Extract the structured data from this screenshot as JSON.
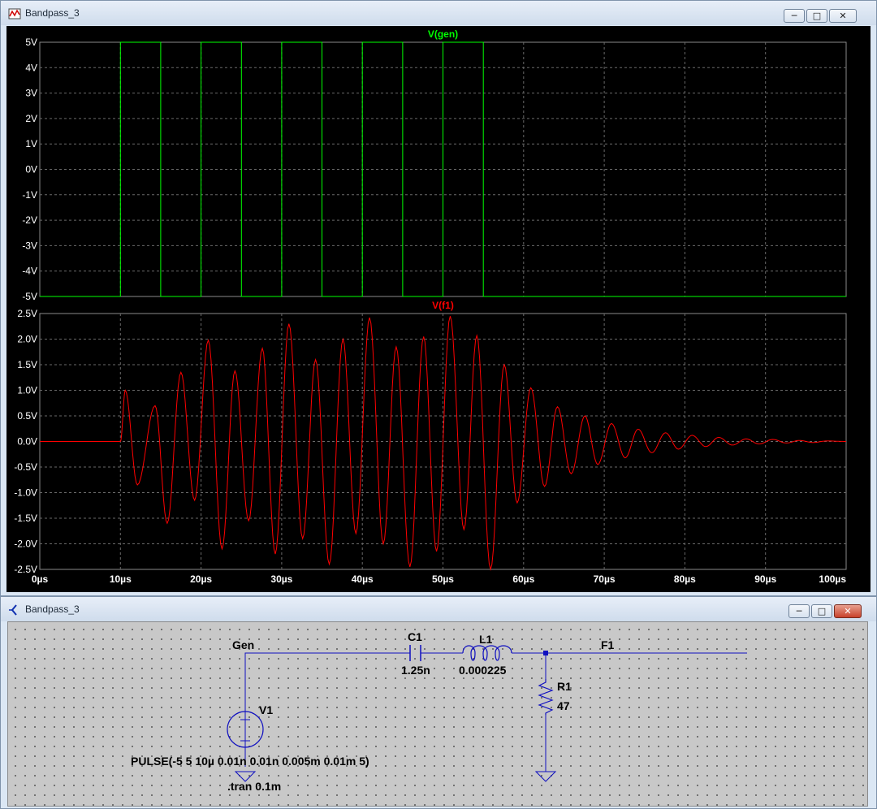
{
  "waveform_window": {
    "title": "Bandpass_3",
    "buttons": {
      "minimize": "─",
      "maximize": "□",
      "close": "✕"
    }
  },
  "schematic_window": {
    "title": "Bandpass_3",
    "buttons": {
      "minimize": "─",
      "maximize": "□",
      "close": "✕"
    }
  },
  "schematic": {
    "net_gen": "Gen",
    "net_f1": "F1",
    "c1_name": "C1",
    "c1_value": "1.25n",
    "l1_name": "L1",
    "l1_value": "0.000225",
    "r1_name": "R1",
    "r1_value": "47",
    "v1_name": "V1",
    "v1_value": "PULSE(-5 5 10µ 0.01n 0.01n 0.005m 0.01m 5)",
    "directive": ".tran 0.1m",
    "colors": {
      "wire": "#1010c0",
      "component": "#1010c0",
      "text": "#000000"
    }
  },
  "chart_data": [
    {
      "type": "line",
      "title": "V(gen)",
      "title_color": "#00ff00",
      "x_ticks": [
        "0µs",
        "10µs",
        "20µs",
        "30µs",
        "40µs",
        "50µs",
        "60µs",
        "70µs",
        "80µs",
        "90µs",
        "100µs"
      ],
      "y_ticks": [
        "5V",
        "4V",
        "3V",
        "2V",
        "1V",
        "0V",
        "-1V",
        "-2V",
        "-3V",
        "-4V",
        "-5V"
      ],
      "xlim": [
        0,
        100
      ],
      "ylim": [
        -5,
        5
      ],
      "grid": true,
      "series": [
        {
          "name": "V(gen)",
          "color": "#00ff00",
          "x": [
            0,
            10,
            10,
            15,
            15,
            20,
            20,
            25,
            25,
            30,
            30,
            35,
            35,
            40,
            40,
            45,
            45,
            50,
            50,
            55,
            55,
            100
          ],
          "y": [
            -5,
            -5,
            5,
            5,
            -5,
            -5,
            5,
            5,
            -5,
            -5,
            5,
            5,
            -5,
            -5,
            5,
            5,
            -5,
            -5,
            5,
            5,
            -5,
            -5
          ]
        }
      ]
    },
    {
      "type": "line",
      "title": "V(f1)",
      "title_color": "#ff0000",
      "x_ticks": [
        "0µs",
        "10µs",
        "20µs",
        "30µs",
        "40µs",
        "50µs",
        "60µs",
        "70µs",
        "80µs",
        "90µs",
        "100µs"
      ],
      "y_ticks": [
        "2.5V",
        "2.0V",
        "1.5V",
        "1.0V",
        "0.5V",
        "0.0V",
        "-0.5V",
        "-1.0V",
        "-1.5V",
        "-2.0V",
        "-2.5V"
      ],
      "xlim": [
        0,
        100
      ],
      "ylim": [
        -2.5,
        2.5
      ],
      "grid": true,
      "series": [
        {
          "name": "V(f1)",
          "color": "#ff0000",
          "x": [
            0,
            10,
            10.6,
            12.1,
            14.3,
            15.8,
            17.5,
            19.2,
            20.9,
            22.6,
            24.2,
            25.9,
            27.6,
            29.2,
            30.9,
            32.6,
            34.2,
            35.9,
            37.6,
            39.2,
            40.9,
            42.6,
            44.2,
            45.9,
            47.6,
            49.2,
            50.9,
            52.6,
            54.2,
            55.9,
            57.6,
            59.2,
            60.9,
            62.6,
            64.2,
            65.9,
            67.6,
            69.2,
            70.9,
            72.6,
            74.2,
            75.9,
            77.6,
            79.2,
            80.9,
            82.6,
            84.2,
            85.9,
            87.6,
            89.2,
            90.9,
            92.6,
            94.2,
            95.9,
            97.6,
            100
          ],
          "y": [
            0,
            0,
            1.0,
            -0.85,
            0.7,
            -1.6,
            1.35,
            -1.15,
            1.98,
            -2.1,
            1.38,
            -1.55,
            1.82,
            -2.2,
            2.3,
            -1.9,
            1.6,
            -2.4,
            2.0,
            -1.8,
            2.42,
            -2.0,
            1.85,
            -2.45,
            2.05,
            -2.15,
            2.45,
            -1.72,
            2.07,
            -2.5,
            1.5,
            -1.2,
            1.05,
            -0.88,
            0.68,
            -0.63,
            0.5,
            -0.45,
            0.35,
            -0.32,
            0.24,
            -0.22,
            0.17,
            -0.15,
            0.12,
            -0.1,
            0.08,
            -0.07,
            0.05,
            -0.05,
            0.04,
            -0.03,
            0.02,
            -0.02,
            0.01,
            0
          ]
        }
      ]
    }
  ]
}
